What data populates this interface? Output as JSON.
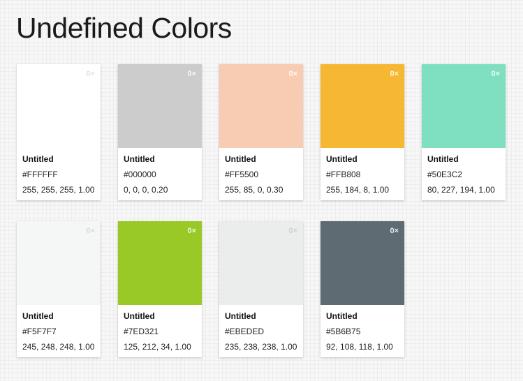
{
  "page": {
    "title": "Undefined Colors"
  },
  "colors": [
    {
      "name": "Untitled",
      "hex": "#FFFFFF",
      "rgba": "255, 255, 255, 1.00",
      "count": "0×",
      "swatch": "#FFFFFF",
      "light": true
    },
    {
      "name": "Untitled",
      "hex": "#000000",
      "rgba": "0, 0, 0, 0.20",
      "count": "0×",
      "swatch": "#CCCCCC",
      "light": false
    },
    {
      "name": "Untitled",
      "hex": "#FF5500",
      "rgba": "255, 85, 0, 0.30",
      "count": "0×",
      "swatch": "#F8CCB2",
      "light": false
    },
    {
      "name": "Untitled",
      "hex": "#FFB808",
      "rgba": "255, 184, 8, 1.00",
      "count": "0×",
      "swatch": "#F6B733",
      "light": false
    },
    {
      "name": "Untitled",
      "hex": "#50E3C2",
      "rgba": "80, 227, 194, 1.00",
      "count": "0×",
      "swatch": "#7FE0C1",
      "light": false
    },
    {
      "name": "Untitled",
      "hex": "#F5F7F7",
      "rgba": "245, 248, 248, 1.00",
      "count": "0×",
      "swatch": "#F5F7F7",
      "light": true
    },
    {
      "name": "Untitled",
      "hex": "#7ED321",
      "rgba": "125, 212, 34, 1.00",
      "count": "0×",
      "swatch": "#98C926",
      "light": false
    },
    {
      "name": "Untitled",
      "hex": "#EBEDED",
      "rgba": "235, 238, 238, 1.00",
      "count": "0×",
      "swatch": "#EBEDED",
      "light": true
    },
    {
      "name": "Untitled",
      "hex": "#5B6B75",
      "rgba": "92, 108, 118, 1.00",
      "count": "0×",
      "swatch": "#5E6B73",
      "light": false
    }
  ]
}
